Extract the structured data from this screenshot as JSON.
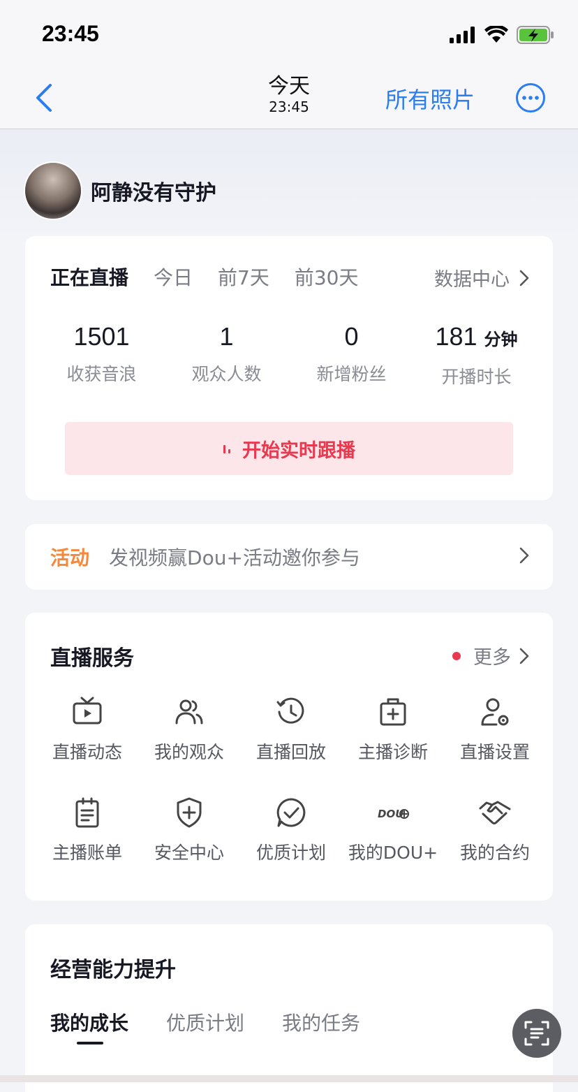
{
  "status_bar": {
    "time": "23:45"
  },
  "nav": {
    "title": "今天",
    "subtitle": "23:45",
    "all_photos": "所有照片"
  },
  "profile": {
    "name": "阿静没有守护"
  },
  "live_card": {
    "tabs": [
      {
        "label": "正在直播",
        "active": true
      },
      {
        "label": "今日"
      },
      {
        "label": "前7天"
      },
      {
        "label": "前30天"
      }
    ],
    "data_center": "数据中心",
    "stats": [
      {
        "value": "1501",
        "label": "收获音浪"
      },
      {
        "value": "1",
        "label": "观众人数"
      },
      {
        "value": "0",
        "label": "新增粉丝"
      },
      {
        "value": "181",
        "unit": "分钟",
        "label": "开播时长"
      }
    ],
    "follow_button": "开始实时跟播"
  },
  "activity": {
    "tag": "活动",
    "text": "发视频赢Dou+活动邀你参与"
  },
  "services": {
    "title": "直播服务",
    "more": "更多",
    "items": [
      {
        "label": "直播动态",
        "icon": "tv-icon"
      },
      {
        "label": "我的观众",
        "icon": "audience-icon"
      },
      {
        "label": "直播回放",
        "icon": "history-icon"
      },
      {
        "label": "主播诊断",
        "icon": "medical-kit-icon"
      },
      {
        "label": "直播设置",
        "icon": "user-settings-icon"
      },
      {
        "label": "主播账单",
        "icon": "clipboard-icon"
      },
      {
        "label": "安全中心",
        "icon": "shield-plus-icon"
      },
      {
        "label": "优质计划",
        "icon": "chat-check-icon"
      },
      {
        "label": "我的DOU+",
        "icon": "dou-plus-icon"
      },
      {
        "label": "我的合约",
        "icon": "handshake-icon"
      }
    ]
  },
  "growth": {
    "title": "经营能力提升",
    "tabs": [
      {
        "label": "我的成长",
        "active": true
      },
      {
        "label": "优质计划"
      },
      {
        "label": "我的任务"
      }
    ]
  },
  "colors": {
    "accent_blue": "#2a7ef0",
    "live_red": "#e8394f",
    "activity_orange": "#f5883a"
  }
}
